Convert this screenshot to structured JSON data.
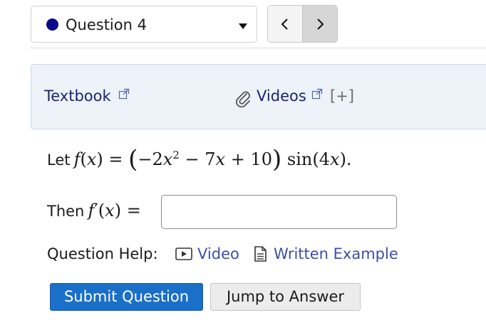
{
  "question_selector": {
    "label": "Question 4",
    "status_color": "#0b0b8a"
  },
  "nav": {
    "prev_icon": "chevron-left-icon",
    "next_icon": "chevron-right-icon"
  },
  "resources": {
    "textbook_label": "Textbook",
    "videos_label": "Videos",
    "expand_label": "[+]"
  },
  "problem": {
    "let_word": "Let",
    "function_name": "f",
    "variable": "x",
    "coef_a": "−2",
    "exponent": "2",
    "coef_b": "7",
    "constant": "10",
    "trig": "sin",
    "trig_coef": "4",
    "then_word": "Then",
    "answer_value": ""
  },
  "help": {
    "label": "Question Help:",
    "video_label": "Video",
    "example_label": "Written Example"
  },
  "buttons": {
    "submit_label": "Submit Question",
    "jump_label": "Jump to Answer"
  },
  "colors": {
    "link": "#1a237e",
    "help_link": "#3b4fa8",
    "submit_bg": "#1a6fc9",
    "panel_bg": "#eef2f9"
  }
}
